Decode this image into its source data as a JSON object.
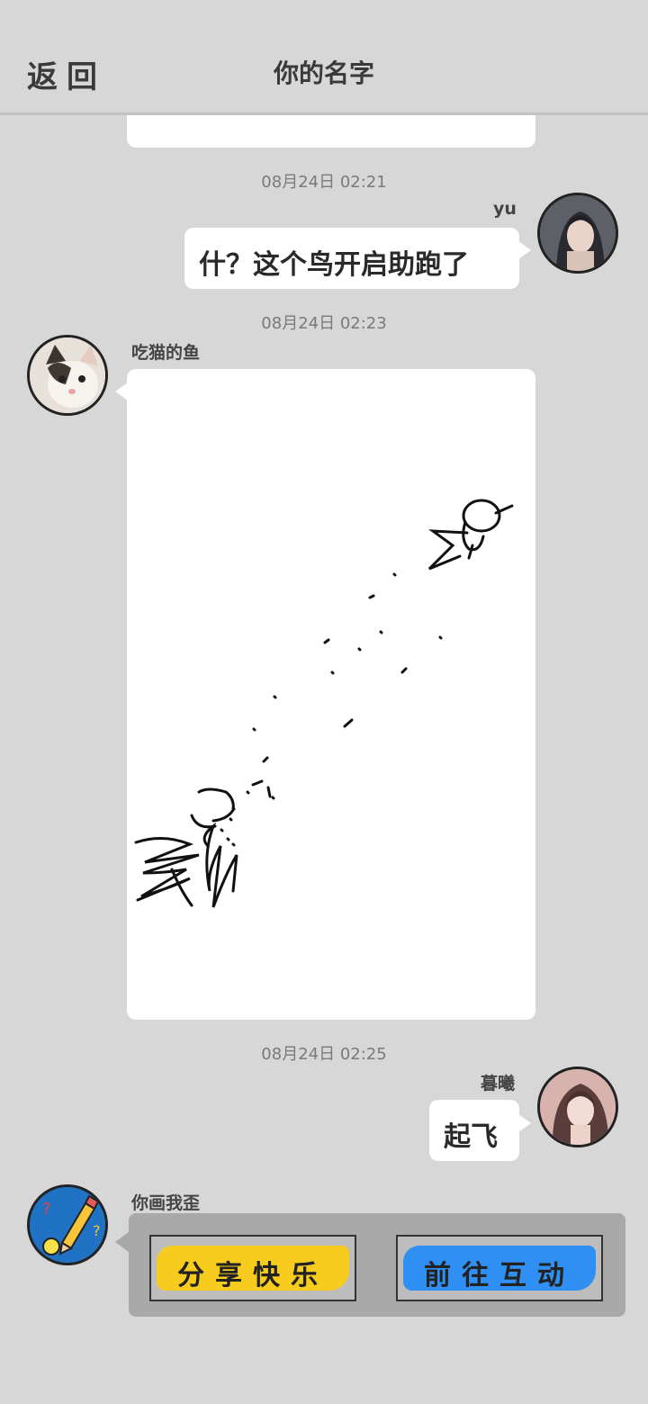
{
  "header": {
    "back_label": "返回",
    "title": "你的名字"
  },
  "messages": [
    {
      "time": "08月24日  02:21",
      "user": "yu",
      "text": "什？这个鸟开启助跑了"
    },
    {
      "time": "08月24日  02:23",
      "user": "吃猫的鱼",
      "image": "bird-drawing"
    },
    {
      "time": "08月24日  02:25",
      "user": "暮曦",
      "text": "起飞"
    },
    {
      "user": "你画我歪",
      "actions": [
        "分享快乐",
        "前往互动"
      ]
    }
  ],
  "colors": {
    "background": "#d7d7d7",
    "bubble": "#ffffff",
    "share_button": "#f8cc1f",
    "interact_button": "#2f8ff2",
    "card": "#a9a9a9"
  },
  "icons": [
    "cat-avatar",
    "girl-avatar",
    "pencil-app-avatar"
  ]
}
